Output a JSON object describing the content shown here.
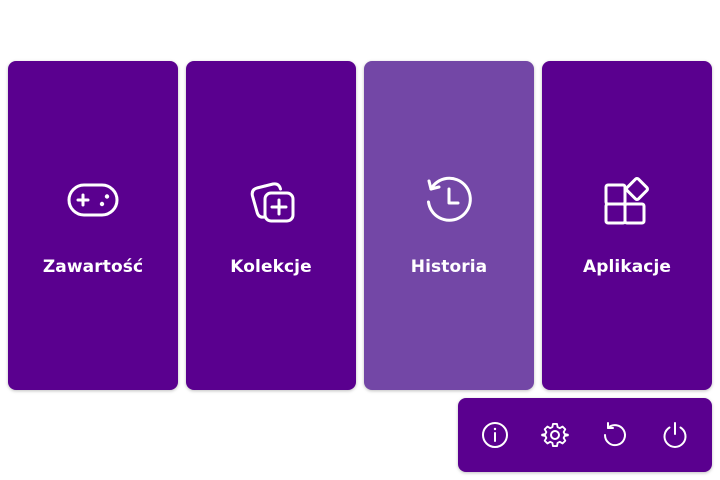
{
  "tiles": [
    {
      "label": "Zawartość",
      "icon": "gamepad-icon",
      "state": "normal"
    },
    {
      "label": "Kolekcje",
      "icon": "collections-add-icon",
      "state": "normal"
    },
    {
      "label": "Historia",
      "icon": "history-icon",
      "state": "hover"
    },
    {
      "label": "Aplikacje",
      "icon": "apps-icon",
      "state": "normal"
    }
  ],
  "power_bar": {
    "buttons": [
      {
        "icon": "info-icon"
      },
      {
        "icon": "settings-gear-icon"
      },
      {
        "icon": "restart-icon"
      },
      {
        "icon": "power-icon"
      }
    ]
  },
  "colors": {
    "tile_bg": "#5a008f",
    "tile_hover_bg": "#7347a6",
    "foreground": "#ffffff",
    "page_bg": "#ffffff"
  }
}
